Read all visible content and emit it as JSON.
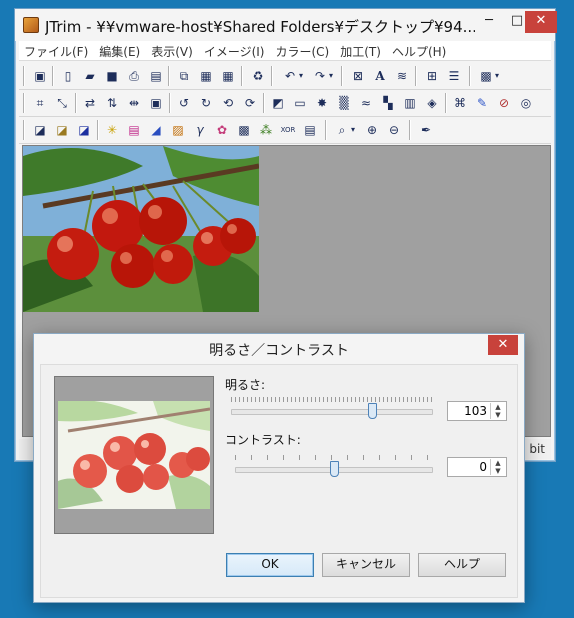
{
  "window": {
    "title": "JTrim - ¥¥vmware-host¥Shared Folders¥デスクトップ¥94...",
    "min_icon": "minimize-icon",
    "max_icon": "maximize-icon",
    "close_icon": "close-icon",
    "min_glyph": "─",
    "max_glyph": "□",
    "close_glyph": "✕"
  },
  "menu": [
    {
      "label": "ファイル(F)"
    },
    {
      "label": "編集(E)"
    },
    {
      "label": "表示(V)"
    },
    {
      "label": "イメージ(I)"
    },
    {
      "label": "カラー(C)"
    },
    {
      "label": "加工(T)"
    },
    {
      "label": "ヘルプ(H)"
    }
  ],
  "toolbar": {
    "row1": [
      "new-window",
      "new",
      "open",
      "save",
      "print",
      "print-preview",
      "copy",
      "paste",
      "paste-new",
      "paste-special",
      "recycle",
      "undo",
      "redo",
      "fit",
      "text",
      "wave",
      "grid",
      "filmstrip",
      "mosaic-menu"
    ],
    "row2": [
      "crop",
      "resize",
      "flip-h",
      "flip-v",
      "mirror",
      "rotate-frame",
      "rotate-90-left",
      "rotate-90-right",
      "rotate-free",
      "rotate",
      "shade",
      "box",
      "burst",
      "noise",
      "wave-effect",
      "blocks",
      "brick",
      "emboss",
      "grid-effect",
      "pen",
      "no-edit",
      "spiral"
    ],
    "row3": [
      "gradient-gray",
      "gradient-gold",
      "gradient-blue",
      "sparkle",
      "rainbow",
      "color-balance",
      "picture",
      "gamma",
      "color-wheel",
      "checker",
      "rgb",
      "xor",
      "gradient-bar",
      "zoom-menu",
      "zoom-in",
      "zoom-out",
      "eyedropper"
    ]
  },
  "status": {
    "tail": "bit"
  },
  "dialog": {
    "title": "明るさ／コントラスト",
    "close_glyph": "✕",
    "brightness_label": "明るさ:",
    "brightness_value": "103",
    "brightness_level": 0.7,
    "contrast_label": "コントラスト:",
    "contrast_value": "0",
    "contrast_level": 0.5,
    "ok": "OK",
    "cancel": "キャンセル",
    "help": "ヘルプ"
  },
  "colors": {
    "desktop": "#1879b5",
    "close_red": "#c8423b",
    "workspace_gray": "#a0a0a0"
  }
}
